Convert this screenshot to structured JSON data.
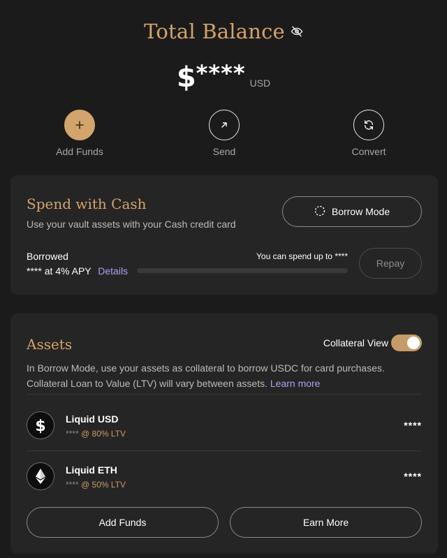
{
  "balance": {
    "title": "Total Balance",
    "currency_symbol": "$",
    "amount_masked": "****",
    "unit": "USD",
    "accent_color": "#d3a46c"
  },
  "actions": [
    {
      "label": "Add Funds",
      "icon": "plus-icon"
    },
    {
      "label": "Send",
      "icon": "arrow-up-right-icon"
    },
    {
      "label": "Convert",
      "icon": "refresh-icon"
    }
  ],
  "spend": {
    "title": "Spend with Cash",
    "subtitle": "Use your vault assets with your Cash credit card",
    "borrow_mode_label": "Borrow Mode",
    "borrowed_label": "Borrowed",
    "borrowed_value": "****",
    "apy_text": "at 4% APY",
    "details_link": "Details",
    "spend_limit_text": "You can spend up to ****",
    "progress": 0,
    "repay_label": "Repay"
  },
  "assets": {
    "title": "Assets",
    "collateral_view_label": "Collateral View",
    "collateral_view_on": true,
    "description_line1": "In Borrow Mode, use your assets as collateral to borrow USDC for card purchases.",
    "description_line2": "Collateral Loan to Value (LTV) will vary between assets.",
    "learn_more": "Learn more",
    "items": [
      {
        "name": "Liquid USD",
        "amount": "****",
        "ltv": "@ 80% LTV",
        "value": "****",
        "icon": "dollar-icon"
      },
      {
        "name": "Liquid ETH",
        "amount": "****",
        "ltv": "@ 50% LTV",
        "value": "****",
        "icon": "ethereum-icon"
      }
    ],
    "add_funds_label": "Add Funds",
    "earn_more_label": "Earn More"
  }
}
